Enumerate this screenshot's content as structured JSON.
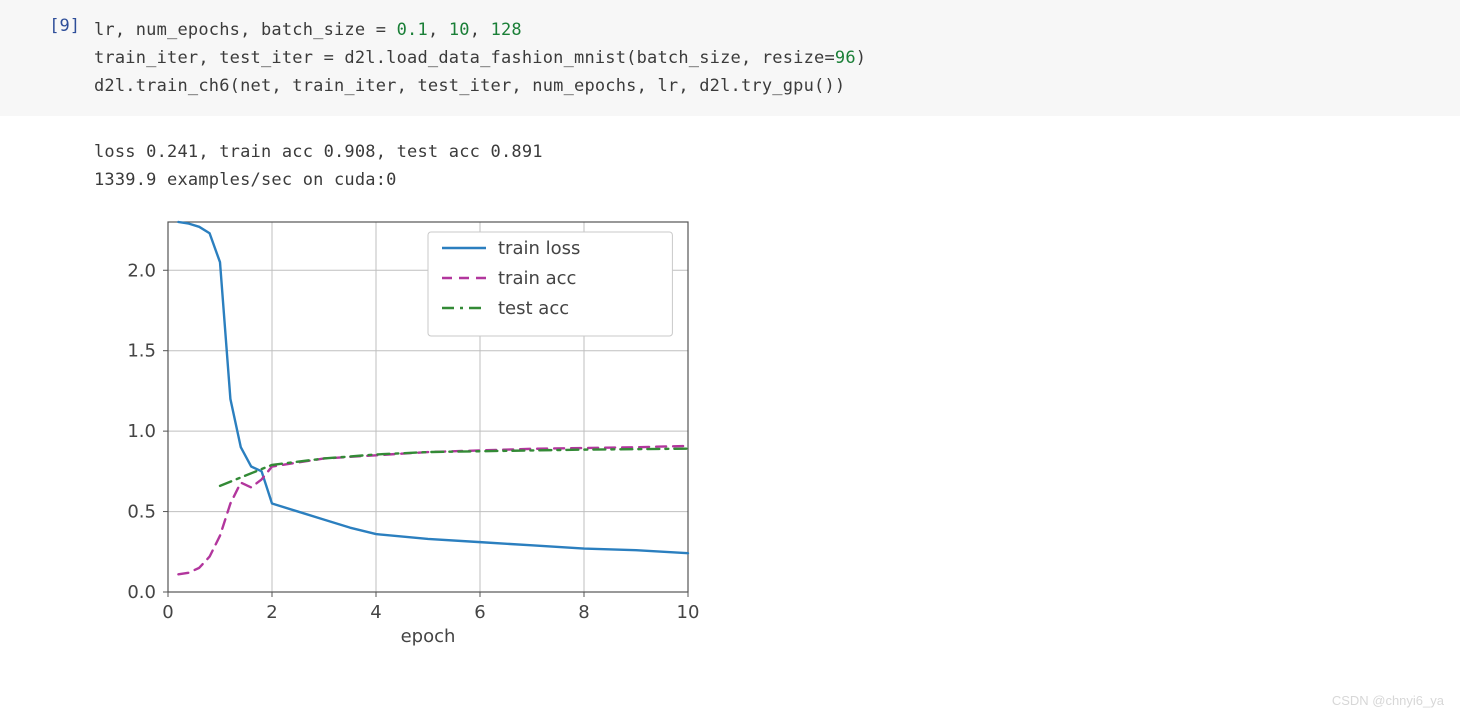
{
  "cell": {
    "prompt": "[9]",
    "code": {
      "line1_pre": "lr, num_epochs, batch_size = ",
      "n1": "0.1",
      "sep1": ", ",
      "n2": "10",
      "sep2": ", ",
      "n3": "128",
      "line2_pre": "train_iter, test_iter = d2l.load_data_fashion_mnist(batch_size, resize=",
      "n4": "96",
      "line2_post": ")",
      "line3": "d2l.train_ch6(net, train_iter, test_iter, num_epochs, lr, d2l.try_gpu())"
    }
  },
  "output": {
    "line1": "loss 0.241, train acc 0.908, test acc 0.891",
    "line2": "1339.9 examples/sec on cuda:0"
  },
  "watermark": "CSDN @chnyi6_ya",
  "chart_data": {
    "type": "line",
    "xlabel": "epoch",
    "ylabel": "",
    "title": "",
    "xlim": [
      0,
      10
    ],
    "ylim": [
      0.0,
      2.3
    ],
    "xticks": [
      0,
      2,
      4,
      6,
      8,
      10
    ],
    "yticks": [
      0.0,
      0.5,
      1.0,
      1.5,
      2.0
    ],
    "legend_position": "upper-right-inset",
    "grid": true,
    "series": [
      {
        "name": "train loss",
        "style": "solid",
        "color": "#2b7fbf",
        "x": [
          0.2,
          0.4,
          0.6,
          0.8,
          1.0,
          1.2,
          1.4,
          1.6,
          1.8,
          2.0,
          2.5,
          3.0,
          3.5,
          4.0,
          5.0,
          6.0,
          7.0,
          8.0,
          9.0,
          10.0
        ],
        "values": [
          2.3,
          2.29,
          2.27,
          2.23,
          2.05,
          1.2,
          0.9,
          0.78,
          0.75,
          0.55,
          0.5,
          0.45,
          0.4,
          0.36,
          0.33,
          0.31,
          0.29,
          0.27,
          0.26,
          0.241
        ]
      },
      {
        "name": "train acc",
        "style": "dashed",
        "color": "#b2369d",
        "x": [
          0.2,
          0.4,
          0.6,
          0.8,
          1.0,
          1.2,
          1.4,
          1.6,
          1.8,
          2.0,
          3.0,
          4.0,
          5.0,
          6.0,
          7.0,
          8.0,
          9.0,
          10.0
        ],
        "values": [
          0.11,
          0.12,
          0.15,
          0.22,
          0.35,
          0.55,
          0.68,
          0.65,
          0.7,
          0.78,
          0.83,
          0.85,
          0.87,
          0.88,
          0.89,
          0.895,
          0.9,
          0.908
        ]
      },
      {
        "name": "test acc",
        "style": "dashdot",
        "color": "#338a36",
        "x": [
          1.0,
          2.0,
          3.0,
          4.0,
          5.0,
          6.0,
          7.0,
          8.0,
          9.0,
          10.0
        ],
        "values": [
          0.66,
          0.79,
          0.83,
          0.855,
          0.87,
          0.875,
          0.88,
          0.885,
          0.888,
          0.891
        ]
      }
    ]
  }
}
